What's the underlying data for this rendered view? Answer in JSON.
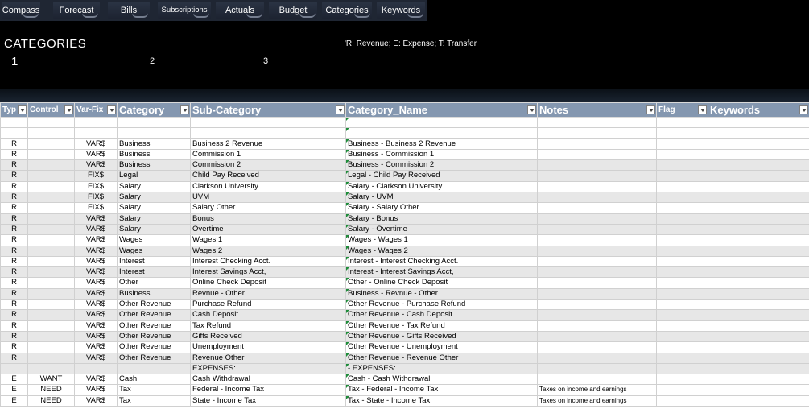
{
  "nav": {
    "tabs": [
      "Compass",
      "Forecast",
      "Bills",
      "Subscriptions",
      "Actuals",
      "Budget",
      "Categories",
      "Keywords"
    ]
  },
  "header": {
    "title": "CATEGORIES",
    "legend": "'R; Revenue; E: Expense; T: Transfer",
    "level1": "1",
    "level2": "2",
    "level3": "3"
  },
  "columns": [
    "Typ",
    "Control",
    "Var-Fix",
    "Category",
    "Sub-Category",
    "Category_Name",
    "Notes",
    "Flag",
    "Keywords"
  ],
  "rows": [
    [
      "",
      "",
      "",
      "",
      "",
      "",
      "",
      "",
      ""
    ],
    [
      "",
      "",
      "",
      "",
      "",
      "",
      "",
      "",
      ""
    ],
    [
      "R",
      "",
      "VAR$",
      "Business",
      "Business 2 Revenue",
      "Business - Business 2 Revenue",
      "",
      "",
      ""
    ],
    [
      "R",
      "",
      "VAR$",
      "Business",
      "Commission 1",
      "Business - Commission 1",
      "",
      "",
      ""
    ],
    [
      "R",
      "",
      "VAR$",
      "Business",
      "Commission 2",
      "Business - Commission 2",
      "",
      "",
      ""
    ],
    [
      "R",
      "",
      "FIX$",
      "Legal",
      "Child Pay Received",
      "Legal - Child Pay Received",
      "",
      "",
      ""
    ],
    [
      "R",
      "",
      "FIX$",
      "Salary",
      "Clarkson University",
      "Salary - Clarkson University",
      "",
      "",
      ""
    ],
    [
      "R",
      "",
      "FIX$",
      "Salary",
      "UVM",
      "Salary - UVM",
      "",
      "",
      ""
    ],
    [
      "R",
      "",
      "FIX$",
      "Salary",
      "Salary Other",
      "Salary - Salary Other",
      "",
      "",
      ""
    ],
    [
      "R",
      "",
      "VAR$",
      "Salary",
      "Bonus",
      "Salary - Bonus",
      "",
      "",
      ""
    ],
    [
      "R",
      "",
      "VAR$",
      "Salary",
      "Overtime",
      "Salary - Overtime",
      "",
      "",
      ""
    ],
    [
      "R",
      "",
      "VAR$",
      "Wages",
      "Wages 1",
      "Wages - Wages 1",
      "",
      "",
      ""
    ],
    [
      "R",
      "",
      "VAR$",
      "Wages",
      "Wages 2",
      "Wages - Wages 2",
      "",
      "",
      ""
    ],
    [
      "R",
      "",
      "VAR$",
      "Interest",
      "Interest Checking Acct.",
      "Interest - Interest Checking Acct.",
      "",
      "",
      ""
    ],
    [
      "R",
      "",
      "VAR$",
      "Interest",
      "Interest Savings Acct,",
      "Interest - Interest Savings Acct,",
      "",
      "",
      ""
    ],
    [
      "R",
      "",
      "VAR$",
      "Other",
      "Online Check Deposit",
      "Other - Online Check Deposit",
      "",
      "",
      ""
    ],
    [
      "R",
      "",
      "VAR$",
      "Business",
      "Revnue - Other",
      "Business - Revnue - Other",
      "",
      "",
      ""
    ],
    [
      "R",
      "",
      "VAR$",
      "Other Revenue",
      "Purchase Refund",
      "Other Revenue - Purchase Refund",
      "",
      "",
      ""
    ],
    [
      "R",
      "",
      "VAR$",
      "Other Revenue",
      "Cash Deposit",
      "Other Revenue - Cash Deposit",
      "",
      "",
      ""
    ],
    [
      "R",
      "",
      "VAR$",
      "Other Revenue",
      "Tax Refund",
      "Other Revenue - Tax Refund",
      "",
      "",
      ""
    ],
    [
      "R",
      "",
      "VAR$",
      "Other Revenue",
      "Gifts Received",
      "Other Revenue - Gifts Received",
      "",
      "",
      ""
    ],
    [
      "R",
      "",
      "VAR$",
      "Other Revenue",
      "Unemployment",
      "Other Revenue - Unemployment",
      "",
      "",
      ""
    ],
    [
      "R",
      "",
      "VAR$",
      "Other Revenue",
      "Revenue Other",
      "Other Revenue - Revenue Other",
      "",
      "",
      ""
    ],
    [
      "",
      "",
      "",
      "",
      "EXPENSES:",
      " - EXPENSES:",
      "",
      "",
      ""
    ],
    [
      "E",
      "WANT",
      "VAR$",
      "Cash",
      "Cash Withdrawal",
      "Cash - Cash Withdrawal",
      "",
      "",
      ""
    ],
    [
      "E",
      "NEED",
      "VAR$",
      "Tax",
      "Federal - Income Tax",
      "Tax - Federal - Income Tax",
      "Taxes on income and earnings",
      "",
      ""
    ],
    [
      "E",
      "NEED",
      "VAR$",
      "Tax",
      "State - Income Tax",
      "Tax - State - Income Tax",
      "Taxes on income and earnings",
      "",
      ""
    ]
  ]
}
